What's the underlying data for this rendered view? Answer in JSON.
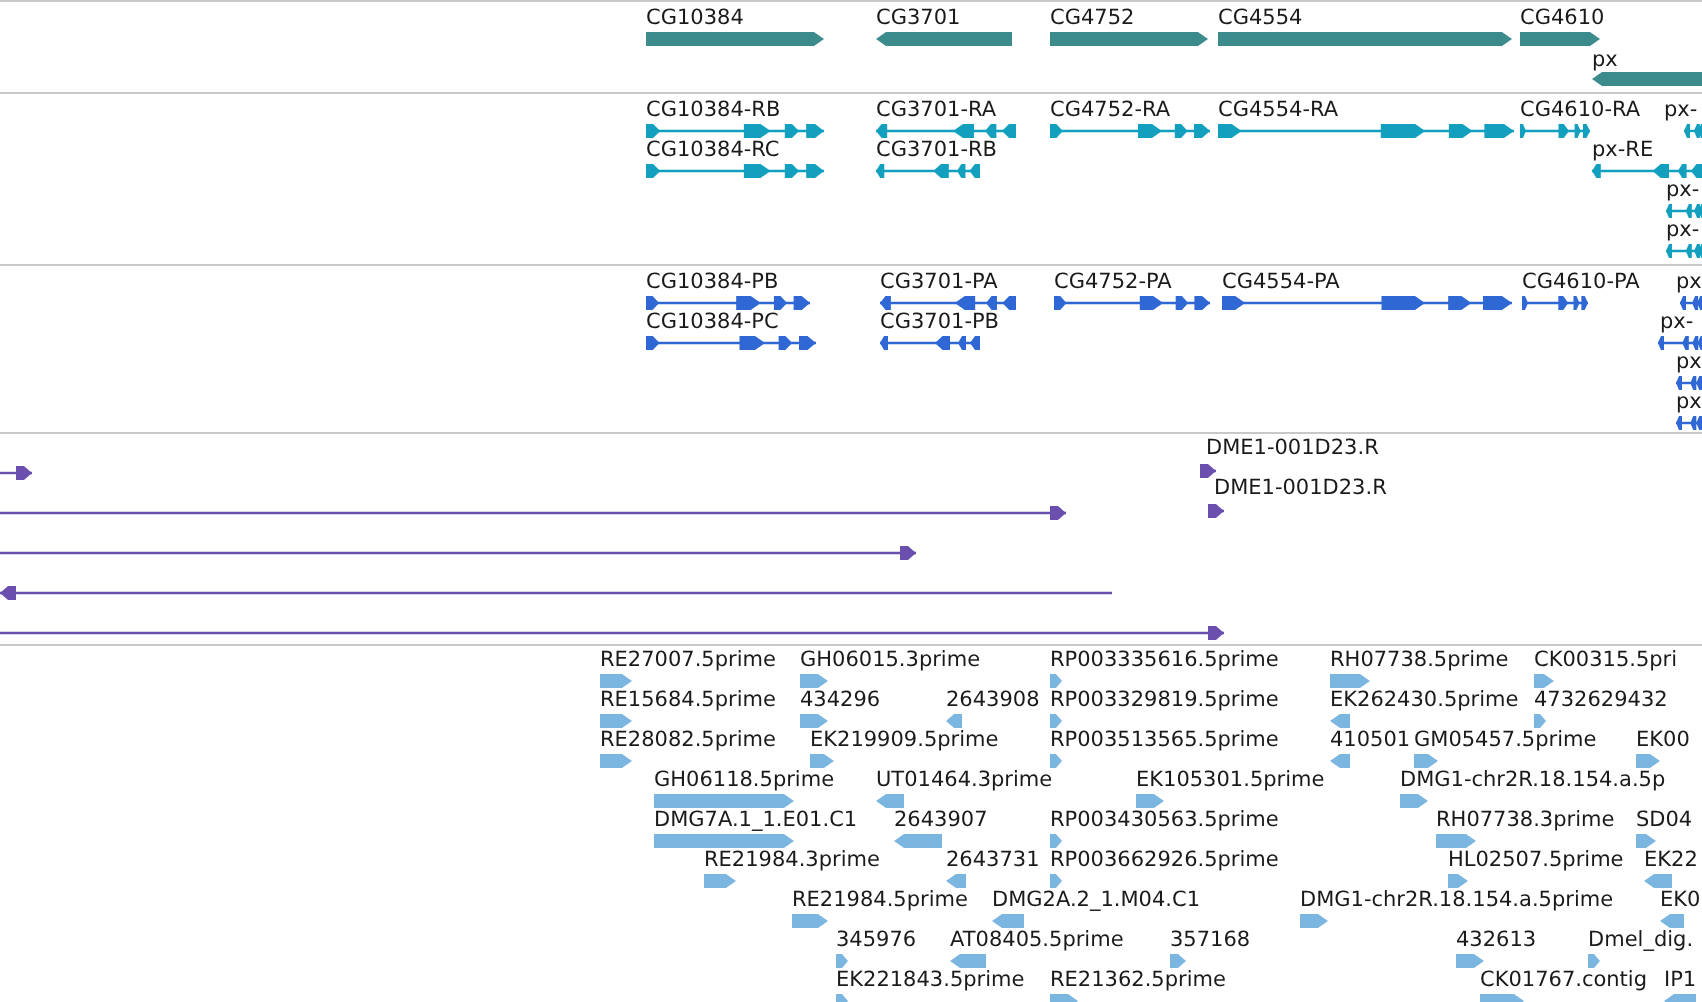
{
  "tracks": [
    {
      "kind": "gene",
      "features": [
        {
          "label": "CG10384",
          "reverse": false
        },
        {
          "label": "CG3701",
          "reverse": true
        },
        {
          "label": "CG4752",
          "reverse": false
        },
        {
          "label": "CG4554",
          "reverse": false
        },
        {
          "label": "CG4610",
          "reverse": false
        },
        {
          "label": "px",
          "reverse": true
        }
      ]
    },
    {
      "kind": "transcript",
      "features": [
        {
          "label": "CG10384-RB",
          "reverse": false
        },
        {
          "label": "CG10384-RC",
          "reverse": false
        },
        {
          "label": "CG3701-RA",
          "reverse": true
        },
        {
          "label": "CG3701-RB",
          "reverse": true
        },
        {
          "label": "CG4752-RA",
          "reverse": false
        },
        {
          "label": "CG4554-RA",
          "reverse": false
        },
        {
          "label": "CG4610-RA",
          "reverse": false
        },
        {
          "label": "px-",
          "reverse": true
        },
        {
          "label": "px-RE",
          "reverse": true
        },
        {
          "label": "px-",
          "reverse": true
        },
        {
          "label": "px-",
          "reverse": true
        }
      ]
    },
    {
      "kind": "protein",
      "features": [
        {
          "label": "CG10384-PB",
          "reverse": false
        },
        {
          "label": "CG10384-PC",
          "reverse": false
        },
        {
          "label": "CG3701-PA",
          "reverse": true
        },
        {
          "label": "CG3701-PB",
          "reverse": true
        },
        {
          "label": "CG4752-PA",
          "reverse": false
        },
        {
          "label": "CG4554-PA",
          "reverse": false
        },
        {
          "label": "CG4610-PA",
          "reverse": false
        },
        {
          "label": "px",
          "reverse": true
        },
        {
          "label": "px-",
          "reverse": true
        },
        {
          "label": "px",
          "reverse": true
        },
        {
          "label": "px",
          "reverse": true
        }
      ]
    },
    {
      "kind": "clone",
      "features": [
        {
          "reverse": false
        },
        {
          "label": "DME1-001D23.R",
          "reverse": false
        },
        {
          "reverse": false
        },
        {
          "label": "DME1-001D23.R",
          "reverse": false
        },
        {
          "reverse": false
        },
        {
          "reverse": true
        },
        {
          "reverse": false
        }
      ]
    },
    {
      "kind": "est",
      "features": [
        {
          "label": "RE27007.5prime",
          "reverse": false
        },
        {
          "label": "GH06015.3prime",
          "reverse": false
        },
        {
          "label": "RP003335616.5prime",
          "reverse": false
        },
        {
          "label": "RH07738.5prime",
          "reverse": false
        },
        {
          "label": "CK00315.5pri",
          "reverse": false
        },
        {
          "label": "RE15684.5prime",
          "reverse": false
        },
        {
          "label": "434296",
          "reverse": false
        },
        {
          "label": "2643908",
          "reverse": true
        },
        {
          "label": "RP003329819.5prime",
          "reverse": false
        },
        {
          "label": "EK262430.5prime",
          "reverse": true
        },
        {
          "label": "4732629432",
          "reverse": false
        },
        {
          "label": "RE28082.5prime",
          "reverse": false
        },
        {
          "label": "EK219909.5prime",
          "reverse": false
        },
        {
          "label": "RP003513565.5prime",
          "reverse": false
        },
        {
          "label": "410501",
          "reverse": true
        },
        {
          "label": "GM05457.5prime",
          "reverse": false
        },
        {
          "label": "EK00",
          "reverse": false
        },
        {
          "label": "GH06118.5prime",
          "reverse": false
        },
        {
          "label": "UT01464.3prime",
          "reverse": true
        },
        {
          "label": "EK105301.5prime",
          "reverse": false
        },
        {
          "label": "DMG1-chr2R.18.154.a.5p",
          "reverse": false
        },
        {
          "label": "DMG7A.1_1.E01.C1",
          "reverse": false
        },
        {
          "label": "2643907",
          "reverse": true
        },
        {
          "label": "RP003430563.5prime",
          "reverse": false
        },
        {
          "label": "RH07738.3prime",
          "reverse": false
        },
        {
          "label": "SD04",
          "reverse": false
        },
        {
          "label": "RE21984.3prime",
          "reverse": false
        },
        {
          "label": "2643731",
          "reverse": true
        },
        {
          "label": "RP003662926.5prime",
          "reverse": false
        },
        {
          "label": "HL02507.5prime",
          "reverse": false
        },
        {
          "label": "EK22",
          "reverse": true
        },
        {
          "label": "RE21984.5prime",
          "reverse": false
        },
        {
          "label": "DMG2A.2_1.M04.C1",
          "reverse": true
        },
        {
          "label": "DMG1-chr2R.18.154.a.5prime",
          "reverse": false
        },
        {
          "label": "EK0",
          "reverse": true
        },
        {
          "label": "345976",
          "reverse": false
        },
        {
          "label": "AT08405.5prime",
          "reverse": true
        },
        {
          "label": "357168",
          "reverse": false
        },
        {
          "label": "432613",
          "reverse": false
        },
        {
          "label": "Dmel_dig.",
          "reverse": false
        },
        {
          "label": "EK221843.5prime",
          "reverse": false
        },
        {
          "label": "RE21362.5prime",
          "reverse": false
        },
        {
          "label": "CK01767.contig",
          "reverse": false
        },
        {
          "label": "IP1",
          "reverse": true
        }
      ]
    }
  ]
}
